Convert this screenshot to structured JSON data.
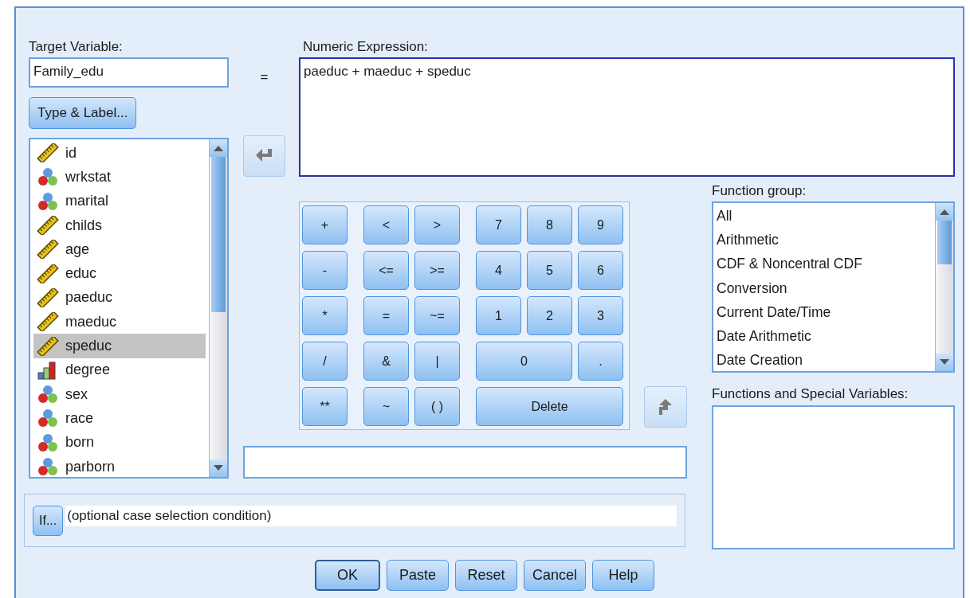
{
  "target_variable": {
    "label": "Target Variable:",
    "value": "Family_edu"
  },
  "type_label_button": "Type & Label...",
  "variables": [
    {
      "name": "id",
      "kind": "scale",
      "selected": false
    },
    {
      "name": "wrkstat",
      "kind": "nominal",
      "selected": false
    },
    {
      "name": "marital",
      "kind": "nominal",
      "selected": false
    },
    {
      "name": "childs",
      "kind": "scale",
      "selected": false
    },
    {
      "name": "age",
      "kind": "scale",
      "selected": false
    },
    {
      "name": "educ",
      "kind": "scale",
      "selected": false
    },
    {
      "name": "paeduc",
      "kind": "scale",
      "selected": false
    },
    {
      "name": "maeduc",
      "kind": "scale",
      "selected": false
    },
    {
      "name": "speduc",
      "kind": "scale",
      "selected": true
    },
    {
      "name": "degree",
      "kind": "ordinal",
      "selected": false
    },
    {
      "name": "sex",
      "kind": "nominal",
      "selected": false
    },
    {
      "name": "race",
      "kind": "nominal",
      "selected": false
    },
    {
      "name": "born",
      "kind": "nominal",
      "selected": false
    },
    {
      "name": "parborn",
      "kind": "nominal",
      "selected": false
    }
  ],
  "equals": "=",
  "insert_button": {
    "disabled": true
  },
  "numeric_expression": {
    "label": "Numeric Expression:",
    "value": "paeduc + maeduc + speduc"
  },
  "keypad": {
    "groups": [
      {
        "keys": [
          {
            "label": "+",
            "kind": "single"
          },
          {
            "label": "-",
            "kind": "single"
          },
          {
            "label": "*",
            "kind": "single"
          },
          {
            "label": "/",
            "kind": "single"
          },
          {
            "label": "**",
            "kind": "single"
          }
        ]
      },
      {
        "keys": [
          {
            "label": "<",
            "kind": "single"
          },
          {
            "label": ">",
            "kind": "single"
          },
          {
            "label": "<=",
            "kind": "single"
          },
          {
            "label": ">=",
            "kind": "single"
          },
          {
            "label": "=",
            "kind": "single"
          },
          {
            "label": "~=",
            "kind": "single"
          },
          {
            "label": "&",
            "kind": "single"
          },
          {
            "label": "|",
            "kind": "single"
          },
          {
            "label": "~",
            "kind": "single"
          },
          {
            "label": "( )",
            "kind": "single"
          }
        ]
      },
      {
        "keys": [
          {
            "label": "7",
            "kind": "single"
          },
          {
            "label": "8",
            "kind": "single"
          },
          {
            "label": "9",
            "kind": "single"
          },
          {
            "label": "4",
            "kind": "single"
          },
          {
            "label": "5",
            "kind": "single"
          },
          {
            "label": "6",
            "kind": "single"
          },
          {
            "label": "1",
            "kind": "single"
          },
          {
            "label": "2",
            "kind": "single"
          },
          {
            "label": "3",
            "kind": "single"
          },
          {
            "label": "0",
            "kind": "double"
          },
          {
            "label": ".",
            "kind": "single"
          },
          {
            "label": "Delete",
            "kind": "triple"
          }
        ]
      }
    ]
  },
  "function_button": {
    "disabled": true
  },
  "function_group": {
    "label": "Function group:",
    "items": [
      {
        "label": "All",
        "selected": false
      },
      {
        "label": "Arithmetic",
        "selected": false
      },
      {
        "label": "CDF & Noncentral CDF",
        "selected": false
      },
      {
        "label": "Conversion",
        "selected": false
      },
      {
        "label": "Current Date/Time",
        "selected": false
      },
      {
        "label": "Date Arithmetic",
        "selected": false
      },
      {
        "label": "Date Creation",
        "selected": false
      }
    ]
  },
  "functions_label": "Functions and Special Variables:",
  "if_button": "If...",
  "if_condition": "(optional case selection condition)",
  "buttons": [
    {
      "label": "OK",
      "default": true
    },
    {
      "label": "Paste",
      "default": false
    },
    {
      "label": "Reset",
      "default": false
    },
    {
      "label": "Cancel",
      "default": false
    },
    {
      "label": "Help",
      "default": false
    }
  ]
}
